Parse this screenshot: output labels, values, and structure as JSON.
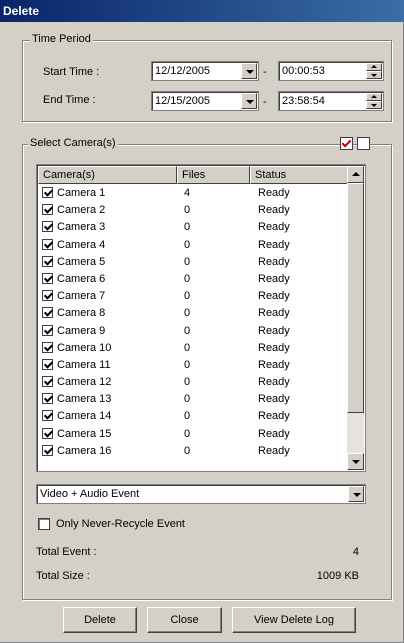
{
  "window": {
    "title": "Delete"
  },
  "time_period": {
    "legend": "Time Period",
    "start_label": "Start Time :",
    "start_date": "12/12/2005",
    "start_time": "00:00:53",
    "end_label": "End Time :",
    "end_date": "12/15/2005",
    "end_time": "23:58:54",
    "separator": "-"
  },
  "cameras": {
    "legend": "Select Camera(s)",
    "columns": [
      "Camera(s)",
      "Files",
      "Status"
    ],
    "rows": [
      {
        "name": "Camera 1",
        "files": "4",
        "status": "Ready"
      },
      {
        "name": "Camera 2",
        "files": "0",
        "status": "Ready"
      },
      {
        "name": "Camera 3",
        "files": "0",
        "status": "Ready"
      },
      {
        "name": "Camera 4",
        "files": "0",
        "status": "Ready"
      },
      {
        "name": "Camera 5",
        "files": "0",
        "status": "Ready"
      },
      {
        "name": "Camera 6",
        "files": "0",
        "status": "Ready"
      },
      {
        "name": "Camera 7",
        "files": "0",
        "status": "Ready"
      },
      {
        "name": "Camera 8",
        "files": "0",
        "status": "Ready"
      },
      {
        "name": "Camera 9",
        "files": "0",
        "status": "Ready"
      },
      {
        "name": "Camera 10",
        "files": "0",
        "status": "Ready"
      },
      {
        "name": "Camera 11",
        "files": "0",
        "status": "Ready"
      },
      {
        "name": "Camera 12",
        "files": "0",
        "status": "Ready"
      },
      {
        "name": "Camera 13",
        "files": "0",
        "status": "Ready"
      },
      {
        "name": "Camera 14",
        "files": "0",
        "status": "Ready"
      },
      {
        "name": "Camera 15",
        "files": "0",
        "status": "Ready"
      },
      {
        "name": "Camera 16",
        "files": "0",
        "status": "Ready"
      }
    ],
    "event_type": "Video + Audio Event",
    "never_recycle_label": "Only Never-Recycle Event",
    "total_event_label": "Total Event :",
    "total_event_value": "4",
    "total_size_label": "Total Size :",
    "total_size_value": "1009 KB"
  },
  "buttons": {
    "delete": "Delete",
    "close": "Close",
    "view_log": "View Delete Log"
  },
  "icons": {
    "check_all": "check-all-icon",
    "uncheck_all": "uncheck-all-icon"
  },
  "colors": {
    "title_bar_start": "#0a246a",
    "title_bar_end": "#3a6ea5",
    "dialog_face": "#d4d0c8"
  }
}
